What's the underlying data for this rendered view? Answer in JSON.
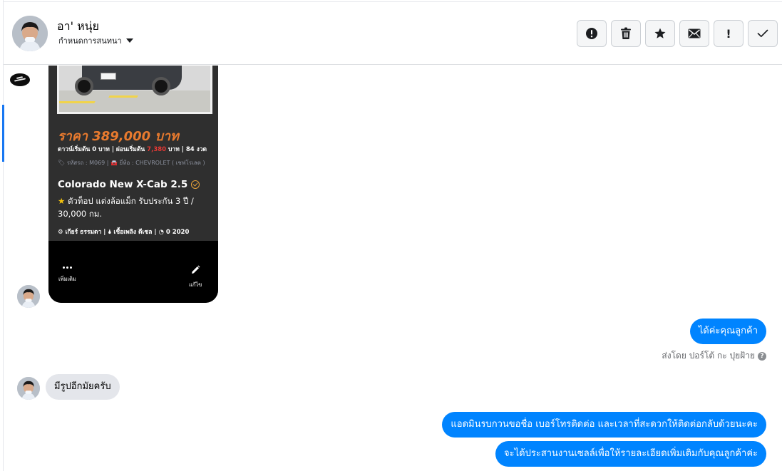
{
  "header": {
    "contact_name": "อา' หนุ่ย",
    "subtitle": "กำหนดการสนทนา",
    "actions": [
      {
        "name": "mark-spam-button",
        "icon": "alert-circle-icon"
      },
      {
        "name": "delete-button",
        "icon": "trash-icon"
      },
      {
        "name": "star-button",
        "icon": "star-icon"
      },
      {
        "name": "mark-unread-button",
        "icon": "envelope-icon"
      },
      {
        "name": "follow-up-button",
        "icon": "exclamation-icon",
        "glyph": "!"
      },
      {
        "name": "mark-done-button",
        "icon": "checkmark-icon"
      }
    ]
  },
  "shared_post": {
    "price": "ราคา 389,000 บาท",
    "terms_prefix": "ดาวน์เริ่มต้น 0 บาท | ผ่อนเริ่มต้น ",
    "terms_highlight": "7,380",
    "terms_suffix": " บาท | 84 งวด",
    "meta": "🏷 รหัสรถ : M069 | 🚘 ยี่ห้อ : CHEVROLET ( เชฟโรเลต )",
    "model": "Colorado New X-Cab 2.5",
    "desc_star": "★",
    "description": "ตัวท็อป แต่งล้อแม็ก รับประกัน 3 ปี / 30,000 กม.",
    "specs": "⚙ เกียร์ ธรรมดา   |  🌢 เชื้อเพลิง ดีเซล   |  ◔ 0 2020",
    "more_label": "เพิ่มเติม",
    "edit_label": "แก้ไข"
  },
  "messages": [
    {
      "direction": "out",
      "text": "ได้ค่ะคุณลูกค้า"
    },
    {
      "direction": "in",
      "text": "มีรูปอีกมัยครับ"
    },
    {
      "direction": "out",
      "text": "แอดมินรบกวนขอชื่อ เบอร์โทรติดต่อ และเวลาที่สะดวกให้ติดต่อกลับด้วยนะคะ"
    },
    {
      "direction": "out",
      "text": "จะได้ประสานงานเซลล์เพื่อให้รายละเอียดเพิ่มเติมกับคุณลูกค้าค่ะ"
    }
  ],
  "sent_by": "ส่งโดย ปอร์โต้ กะ ปุยฝ้าย",
  "help_glyph": "?",
  "colors": {
    "accent": "#1877f2",
    "outgoing_bubble": "#0084ff",
    "incoming_bubble": "#e4e6eb",
    "price_orange": "#e87a2e",
    "highlight_red": "#e53935"
  }
}
